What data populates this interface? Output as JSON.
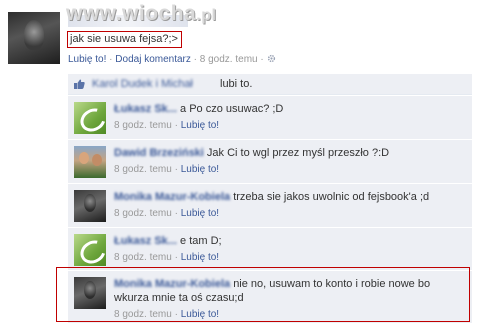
{
  "watermark": {
    "text": "www.wiocha",
    "suffix": ".pl"
  },
  "post": {
    "text": "jak sie usuwa fejsa?;>",
    "meta": {
      "like_label": "Lubię to!",
      "separator": "·",
      "comment_label": "Dodaj komentarz",
      "time": "8 godz. temu",
      "gear_icon": "gear-icon"
    }
  },
  "likes": {
    "icon": "thumbs-up-icon",
    "names": "Karol Dudek i Michał",
    "suffix": "lubi to."
  },
  "comments": [
    {
      "avatar": "green",
      "author": "Łukasz Sk...",
      "text": "a Po czo usuwac? ;D",
      "time": "8 godz. temu",
      "like_label": "Lubię to!"
    },
    {
      "avatar": "people",
      "author": "Dawid Brzeziński",
      "text": "Jak Ci to wgl przez myśl przeszło ?:D",
      "time": "8 godz. temu",
      "like_label": "Lubię to!"
    },
    {
      "avatar": "dark",
      "author": "Monika Mazur-Kobiela",
      "text": "trzeba sie jakos uwolnic od fejsbook'a ;d",
      "time": "8 godz. temu",
      "like_label": "Lubię to!"
    },
    {
      "avatar": "green",
      "author": "Łukasz Sk...",
      "text": "e tam D;",
      "time": "8 godz. temu",
      "like_label": "Lubię to!"
    },
    {
      "avatar": "dark",
      "author": "Monika Mazur-Kobiela",
      "text": "nie no, usuwam to konto i robie nowe bo wkurza mnie ta oś czasu;d",
      "time": "8 godz. temu",
      "like_label": "Lubię to!"
    }
  ],
  "colors": {
    "link": "#3b5998",
    "meta": "#999999",
    "comment_bg": "#edeff4",
    "highlight": "#c00000"
  }
}
